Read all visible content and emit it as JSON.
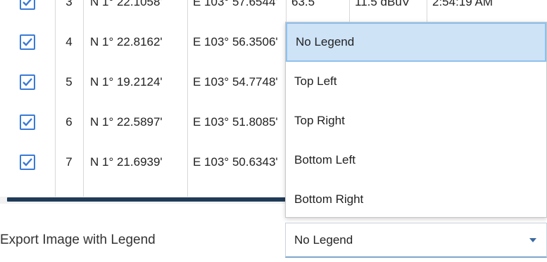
{
  "table": {
    "rows": [
      {
        "id": "3",
        "lat": "N 1° 22.1058'",
        "lon": "E 103° 57.6544'",
        "alt": "63.5",
        "signal": "11.5 dBuV",
        "time": "2:54:19 AM",
        "checked": true
      },
      {
        "id": "4",
        "lat": "N 1° 22.8162'",
        "lon": "E 103° 56.3506'",
        "checked": true
      },
      {
        "id": "5",
        "lat": "N 1° 19.2124'",
        "lon": "E 103° 54.7748'",
        "checked": true
      },
      {
        "id": "6",
        "lat": "N 1° 22.5897'",
        "lon": "E 103° 51.8085'",
        "checked": true
      },
      {
        "id": "7",
        "lat": "N 1° 21.6939'",
        "lon": "E 103° 50.6343'",
        "checked": true
      }
    ]
  },
  "export": {
    "label": "Export Image with Legend",
    "selected_value": "No Legend"
  },
  "legend_menu": {
    "options": [
      "No Legend",
      "Top Left",
      "Top Right",
      "Bottom Left",
      "Bottom Right"
    ],
    "selected_index": 0
  },
  "colors": {
    "accent": "#3a7bd5",
    "selected_bg": "#cfe3f7",
    "scrollbar": "#1f3b57"
  },
  "icons": {
    "checkbox": "checkmark-icon",
    "dropdown": "chevron-down-icon"
  }
}
